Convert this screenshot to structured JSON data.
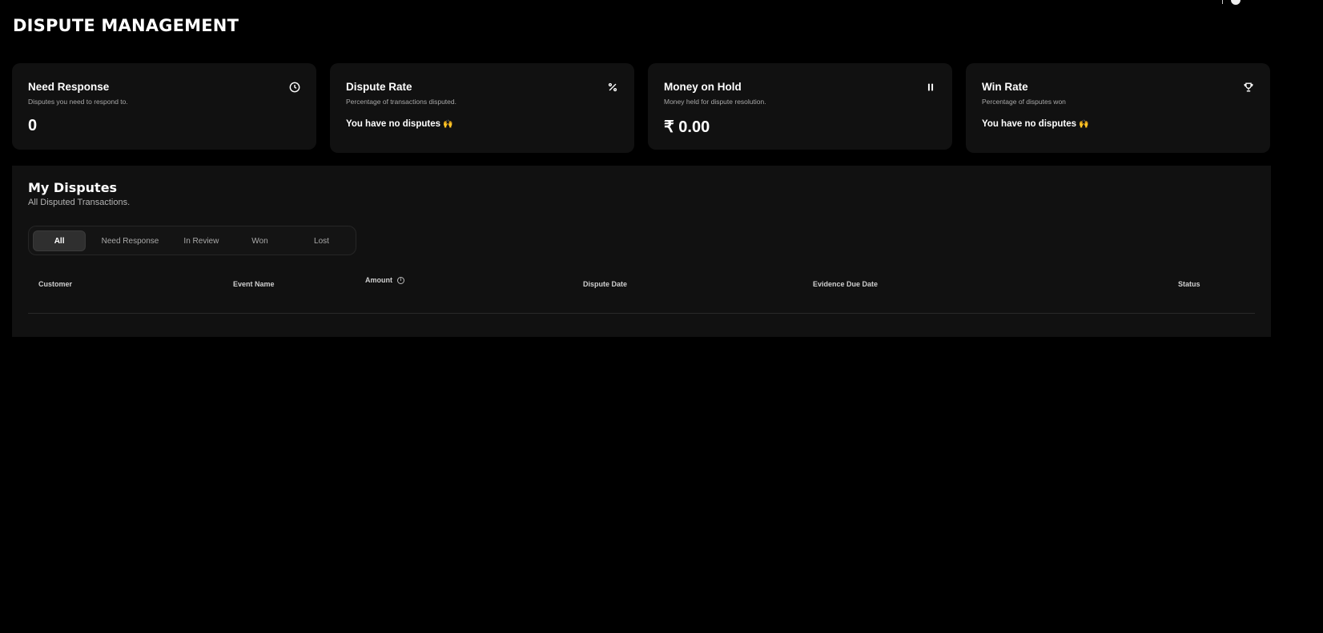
{
  "page": {
    "title": "DISPUTE MANAGEMENT"
  },
  "cards": [
    {
      "title": "Need Response",
      "subtitle": "Disputes you need to respond to.",
      "value": "0",
      "icon": "clock-icon"
    },
    {
      "title": "Dispute Rate",
      "subtitle": "Percentage of transactions disputed.",
      "empty_text": "You have no disputes",
      "emoji": "🙌",
      "icon": "percent-icon"
    },
    {
      "title": "Money on Hold",
      "subtitle": "Money held for dispute resolution.",
      "value": "₹ 0.00",
      "icon": "pause-icon"
    },
    {
      "title": "Win Rate",
      "subtitle": "Percentage of disputes won",
      "empty_text": "You have no disputes",
      "emoji": "🙌",
      "icon": "trophy-icon"
    }
  ],
  "disputes": {
    "title": "My Disputes",
    "subtitle": "All Disputed Transactions.",
    "tabs": [
      {
        "label": "All",
        "active": true
      },
      {
        "label": "Need Response",
        "active": false
      },
      {
        "label": "In Review",
        "active": false
      },
      {
        "label": "Won",
        "active": false
      },
      {
        "label": "Lost",
        "active": false
      }
    ],
    "columns": [
      "Customer",
      "Event Name",
      "Amount",
      "Dispute Date",
      "Evidence Due Date",
      "Status"
    ],
    "rows": []
  },
  "colors": {
    "background": "#000000",
    "card": "#111111",
    "accent_emoji": "#f2b01e"
  }
}
